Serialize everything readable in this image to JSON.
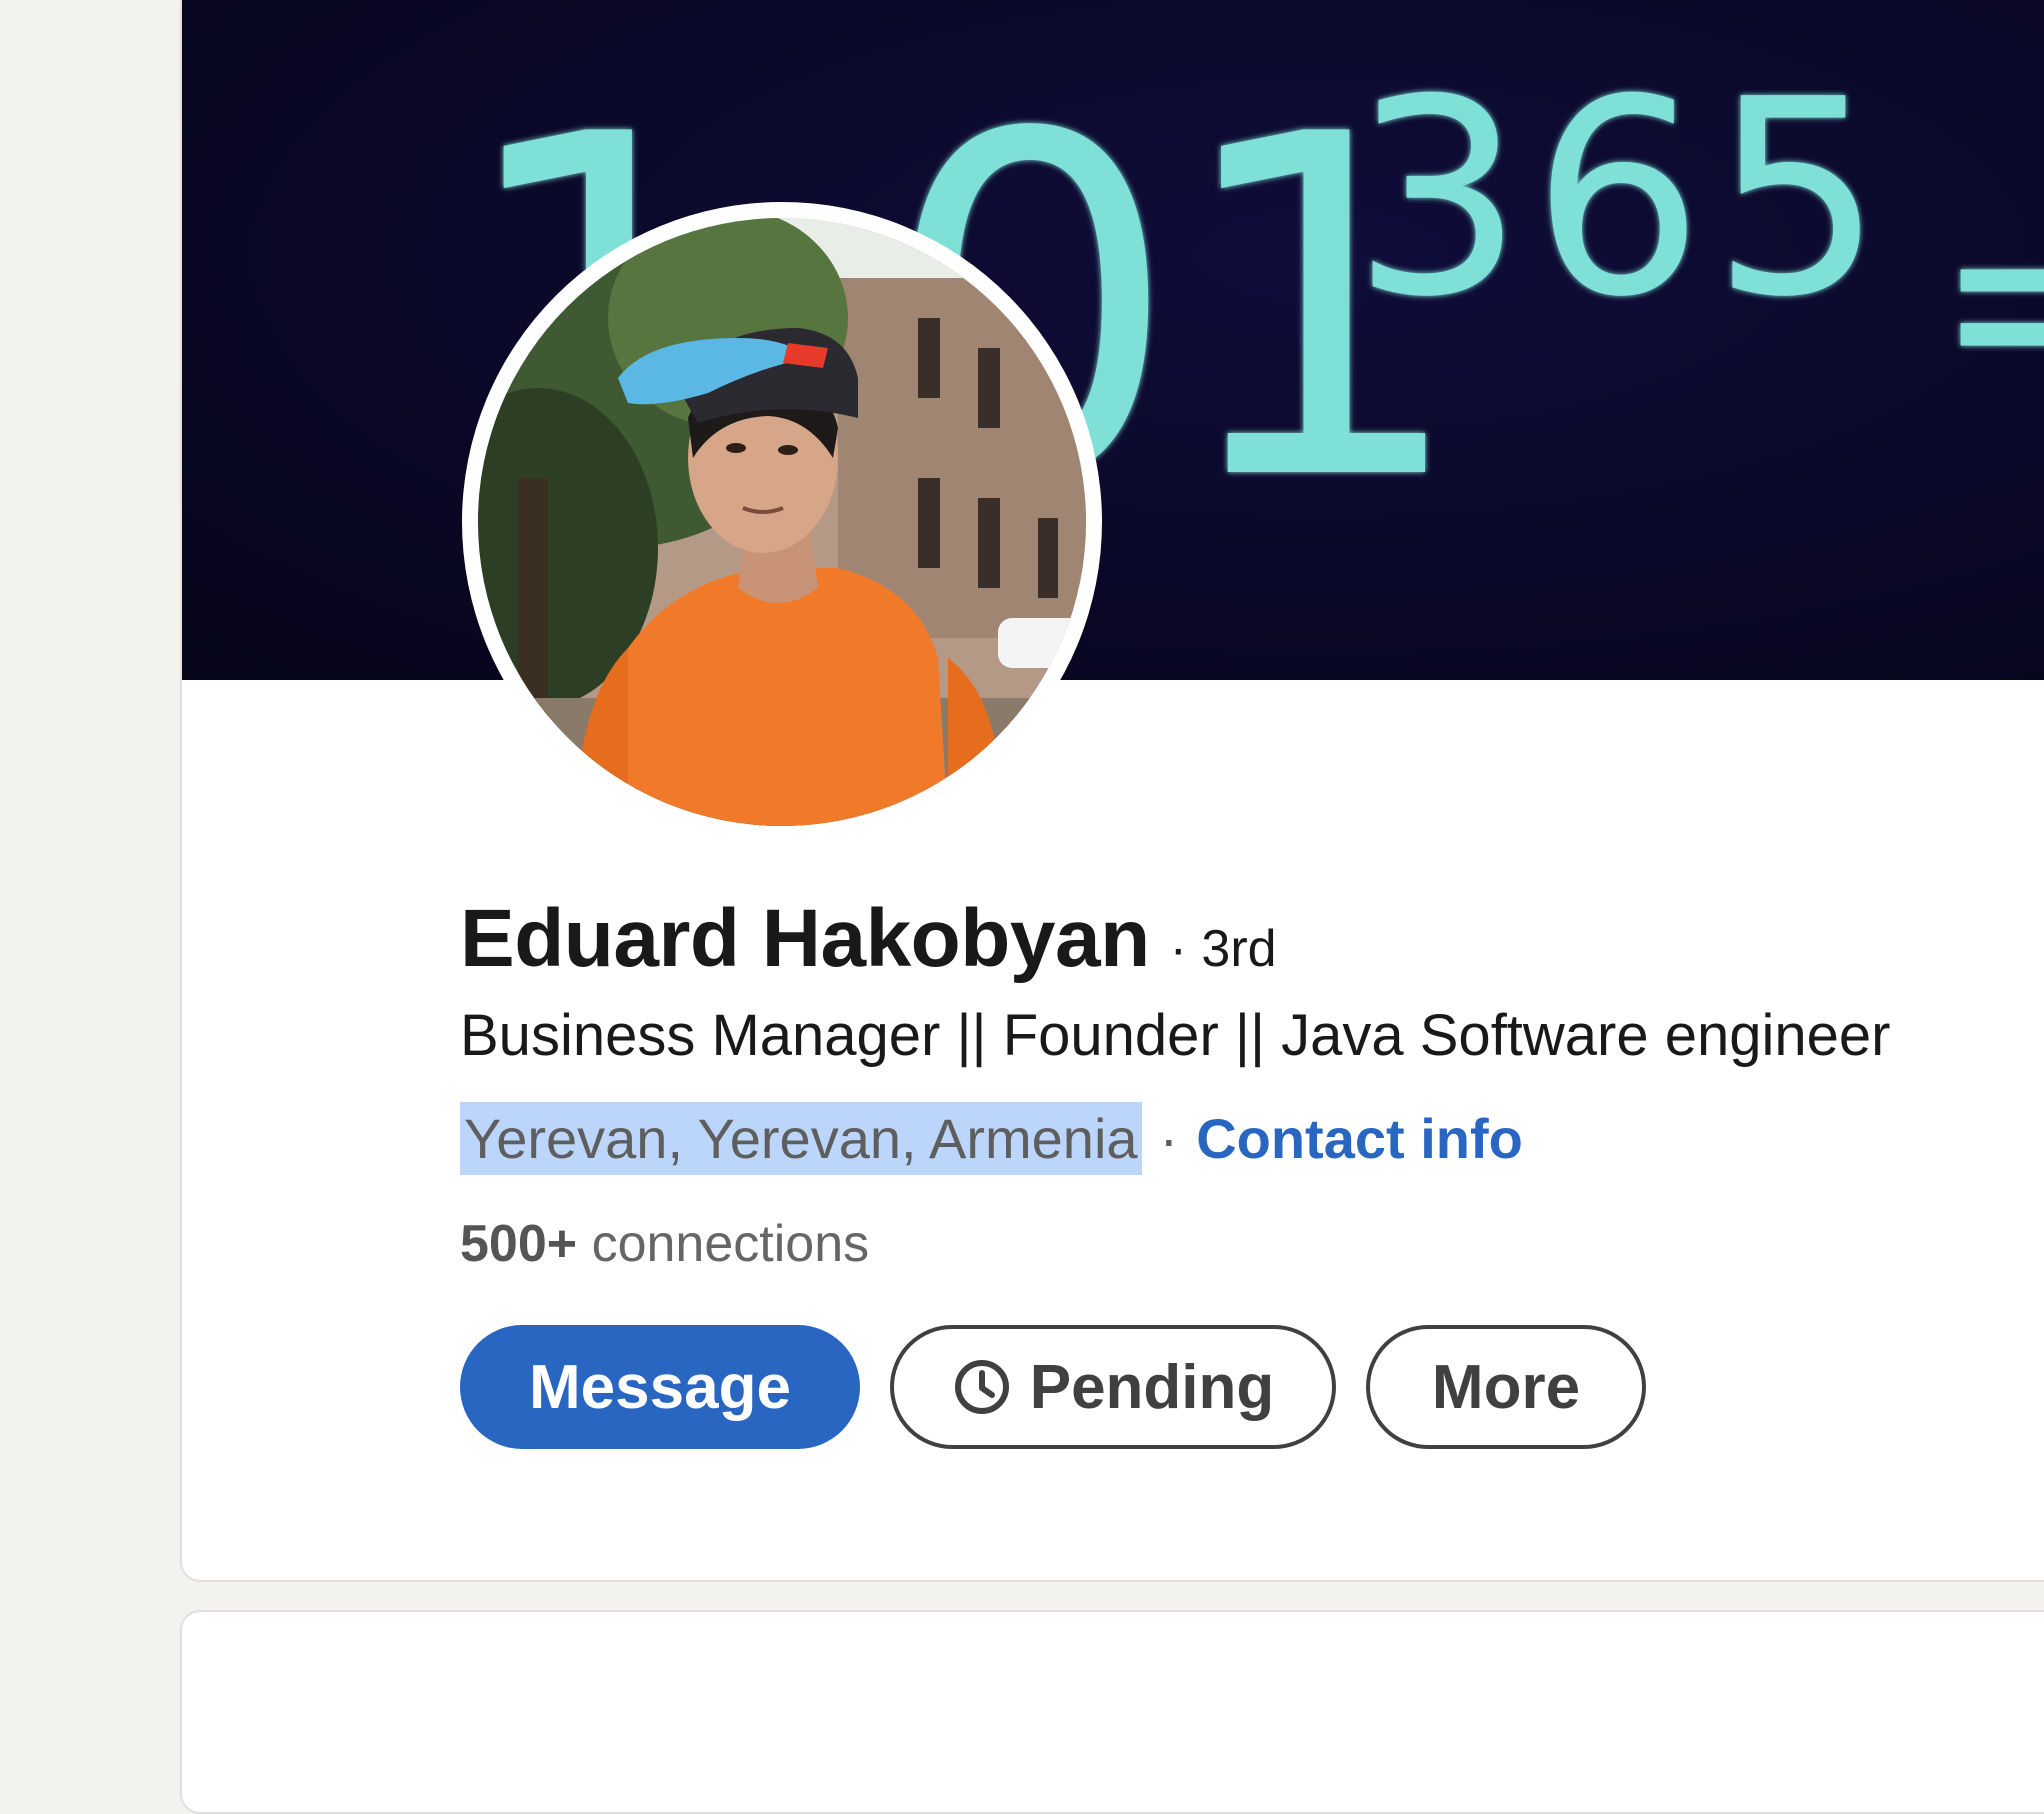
{
  "banner": {
    "base_text": "1.01",
    "exponent_text": "365",
    "equals_text": "=",
    "text_color": "#7fe0d8",
    "background": "#0a0826"
  },
  "profile": {
    "name": "Eduard Hakobyan",
    "degree": "· 3rd",
    "headline": "Business Manager || Founder || Java Software engineer",
    "location": "Yerevan, Yerevan, Armenia",
    "separator": "·",
    "contact_label": "Contact info",
    "connections_count": "500+",
    "connections_label": "connections"
  },
  "actions": {
    "message_label": "Message",
    "pending_label": "Pending",
    "pending_icon": "clock-icon",
    "more_label": "More"
  },
  "colors": {
    "accent": "#2866c2",
    "selection_highlight": "#bcd6fb",
    "page_background": "#f3f2ef"
  }
}
